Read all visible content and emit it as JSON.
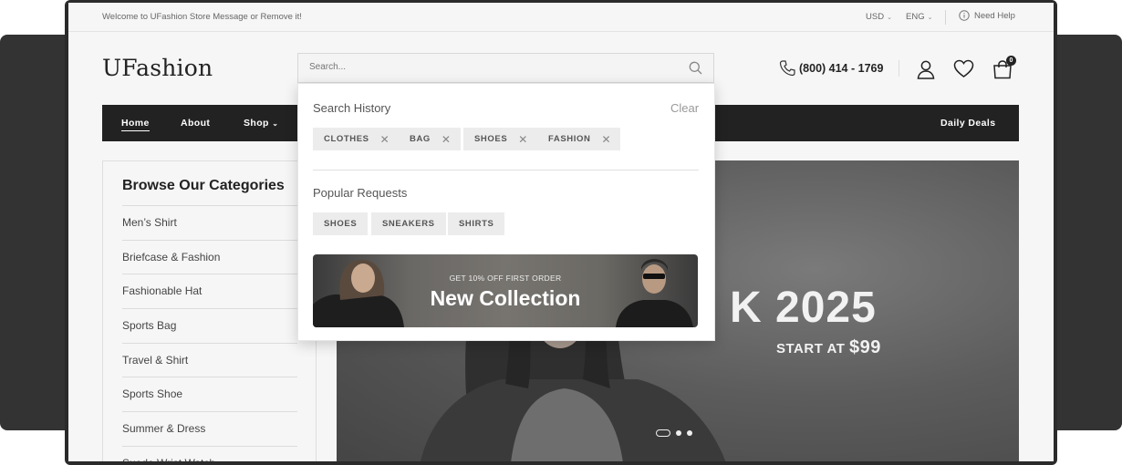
{
  "topbar": {
    "welcome": "Welcome to UFashion Store Message or Remove it!",
    "currency": "USD",
    "language": "ENG",
    "help": "Need Help"
  },
  "header": {
    "logo": "UFashion",
    "search_placeholder": "Search...",
    "phone": "(800) 414 - 1769",
    "cart_count": "0"
  },
  "nav": {
    "items": [
      {
        "label": "Home"
      },
      {
        "label": "About"
      },
      {
        "label": "Shop"
      }
    ],
    "right_item": "Daily Deals"
  },
  "sidebar": {
    "title": "Browse Our Categories",
    "categories": [
      "Men’s Shirt",
      "Briefcase & Fashion",
      "Fashionable Hat",
      "Sports Bag",
      "Travel & Shirt",
      "Sports Shoe",
      "Summer & Dress",
      "Suede Wrist Watch"
    ]
  },
  "hero": {
    "headline": "K 2025",
    "start_text": "START AT",
    "price": "$99"
  },
  "search_dropdown": {
    "history_title": "Search History",
    "clear_label": "Clear",
    "history_tags": [
      "CLOTHES",
      "BAG",
      "SHOES",
      "FASHION"
    ],
    "popular_title": "Popular Requests",
    "popular_tags": [
      "SHOES",
      "SNEAKERS",
      "SHIRTS"
    ],
    "banner_small": "GET 10% OFF FIRST ORDER",
    "banner_big": "New Collection"
  },
  "icons": {
    "info": "info-icon",
    "search": "search-icon",
    "phone": "phone-icon",
    "user": "user-icon",
    "wishlist": "heart-icon",
    "cart": "cart-icon"
  },
  "colors": {
    "nav_bg": "#222222",
    "page_bg": "#f6f6f6",
    "tag_bg": "#ececec"
  }
}
